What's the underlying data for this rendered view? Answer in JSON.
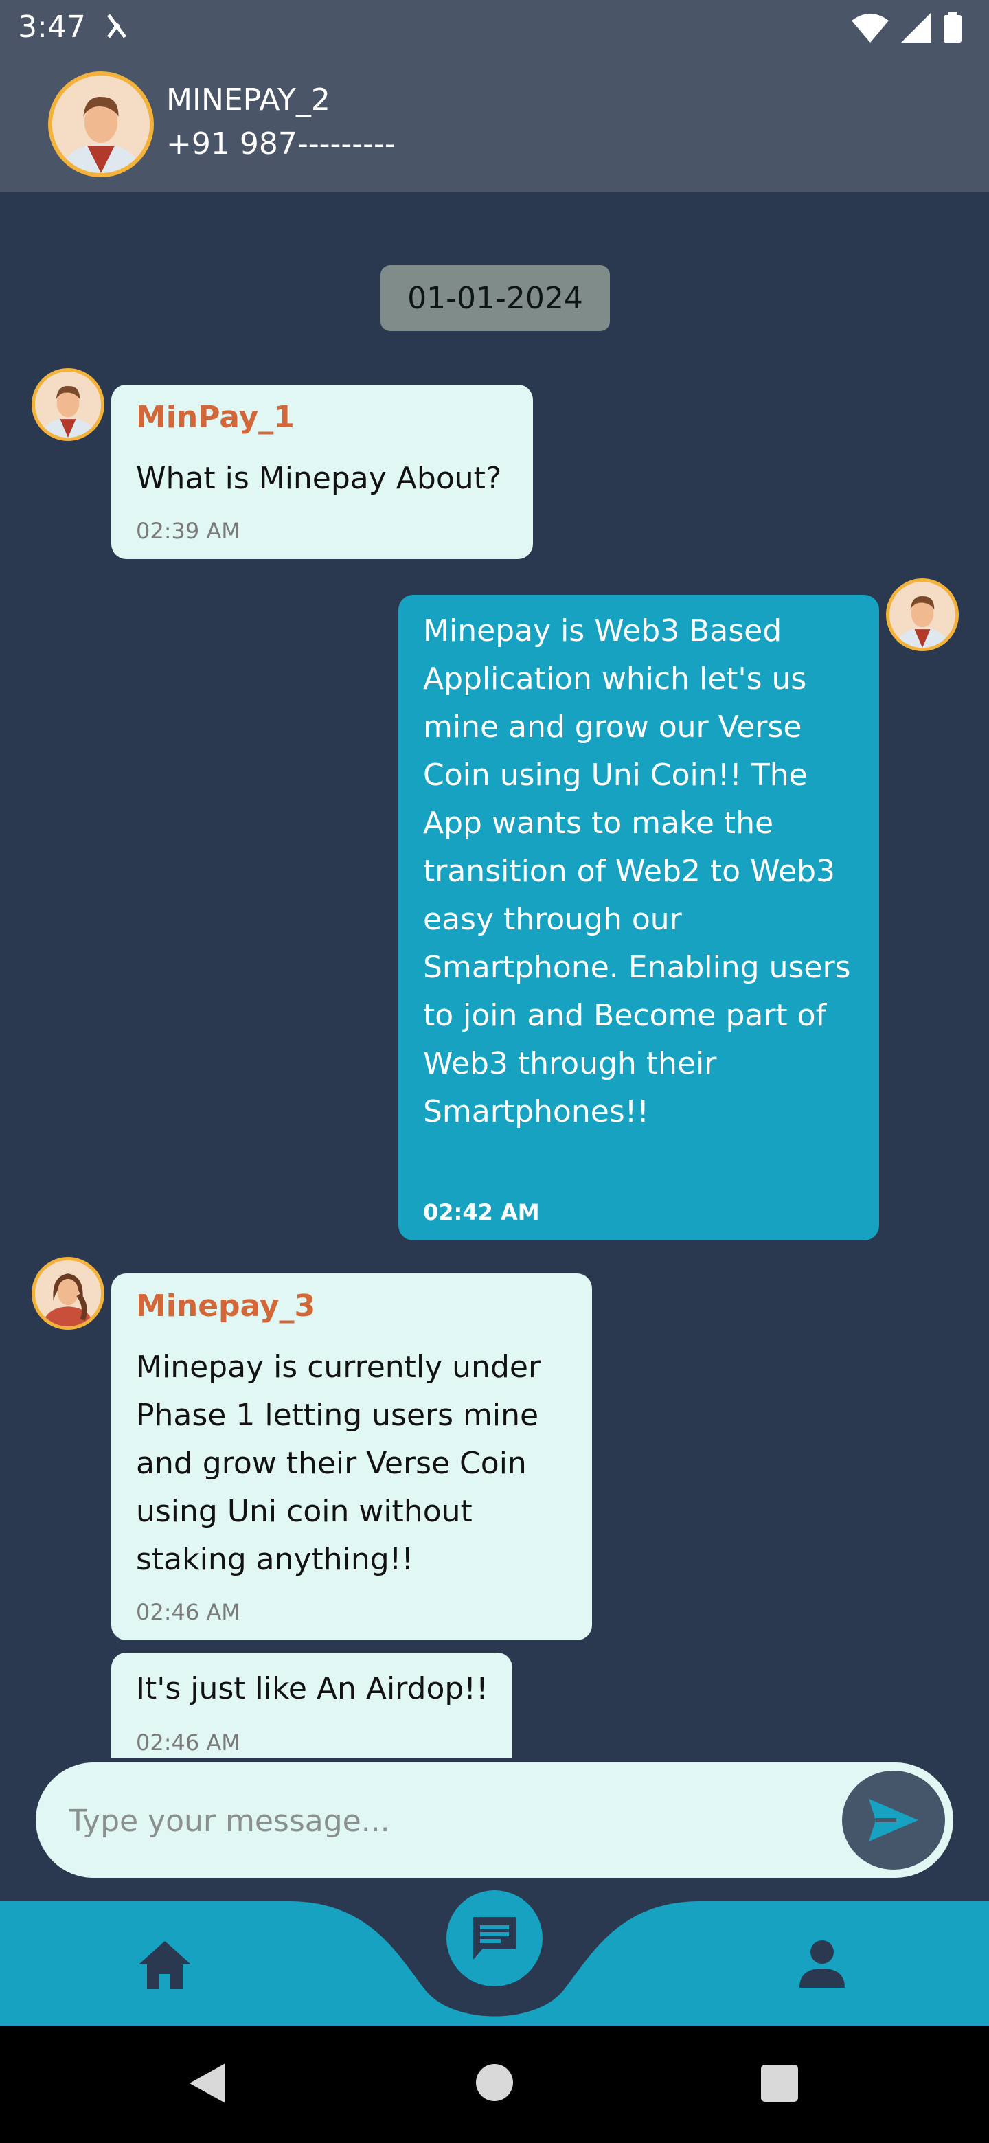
{
  "status_bar": {
    "time": "3:47"
  },
  "header": {
    "name": "MINEPAY_2",
    "phone": "+91 987---------"
  },
  "date_chip": "01-01-2024",
  "messages": [
    {
      "sender": "MinPay_1",
      "text": "What is Minepay About?",
      "time": "02:39 AM",
      "direction": "incoming"
    },
    {
      "sender": "",
      "text": "Minepay is Web3 Based Application which let's us mine and grow our Verse Coin using Uni Coin!! The App wants to make the transition of Web2 to Web3 easy through our Smartphone. Enabling users to join and Become part of Web3 through their Smartphones!!",
      "time": "02:42 AM",
      "direction": "outgoing"
    },
    {
      "sender": "Minepay_3",
      "text": "Minepay is currently under Phase 1 letting users mine and grow their Verse Coin using Uni coin without staking anything!!",
      "time": "02:46 AM",
      "direction": "incoming"
    },
    {
      "sender": "",
      "text": "It's just like An Airdop!!",
      "time": "02:46 AM",
      "direction": "incoming"
    }
  ],
  "composer": {
    "placeholder": "Type your message..."
  },
  "bottom_nav": {
    "items": [
      "home-icon",
      "chat-icon",
      "person-icon"
    ]
  },
  "colors": {
    "background": "#2b3950",
    "header": "#4a5567",
    "incoming_bubble": "#e1f7f4",
    "outgoing_bubble": "#17a2c2",
    "sender_name": "#d2673a",
    "avatar_border": "#f3b23a"
  }
}
